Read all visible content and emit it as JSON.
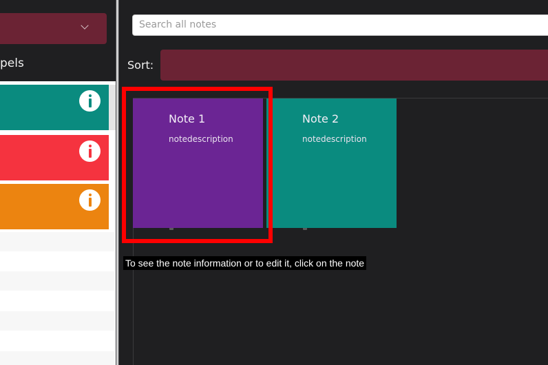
{
  "sidebar": {
    "labels_heading": "pels",
    "label_items": [
      {
        "color": "#0a8b7f",
        "selected": true
      },
      {
        "color": "#f5333f",
        "selected": false
      },
      {
        "color": "#ec8410",
        "selected": false
      }
    ]
  },
  "search": {
    "placeholder": "Search all notes",
    "value": ""
  },
  "sort": {
    "label": "Sort:"
  },
  "notes": [
    {
      "title": "Note 1",
      "description": "notedescription",
      "color": "#6b2594"
    },
    {
      "title": "Note 2",
      "description": "notedescription",
      "color": "#0a8b7f"
    }
  ],
  "tutorial": {
    "caption": "To see the note information or to edit it, click on the note",
    "highlight_color": "#ff0000"
  },
  "colors": {
    "accent": "#6b2334",
    "background": "#1f1f21"
  }
}
